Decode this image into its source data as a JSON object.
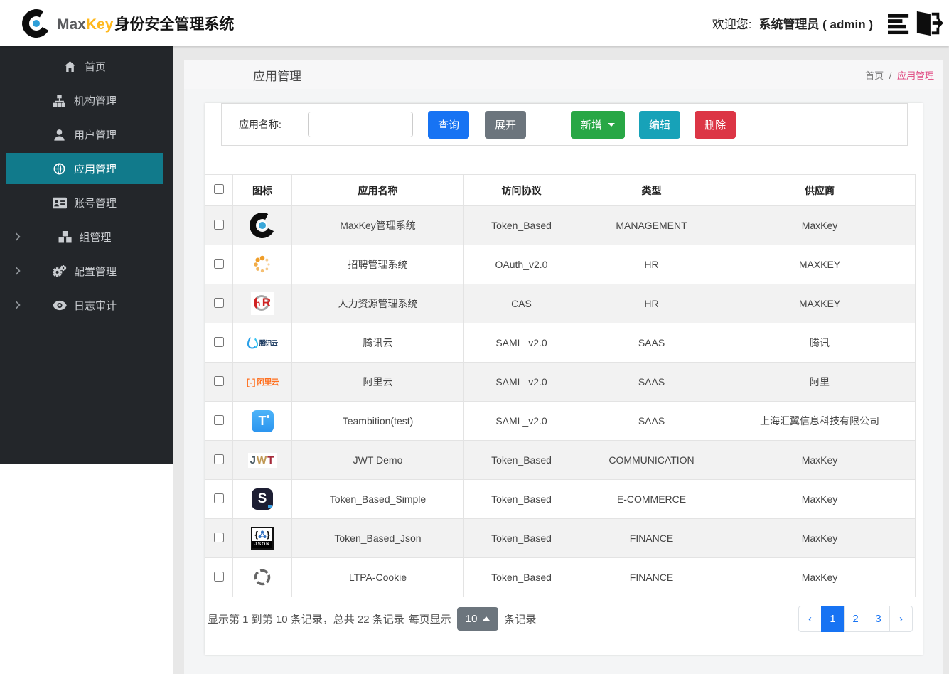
{
  "colors": {
    "primary_blue": "#1773f3",
    "green": "#28a745",
    "teal": "#17a2b8",
    "red": "#dc3545",
    "gray": "#6c757d",
    "sidebar_active": "#117a8b",
    "breadcrumb_pink": "#e0457f",
    "brand_yellow": "#ffb81c"
  },
  "header": {
    "logo": {
      "max": "Max",
      "key": "Key",
      "suffix": "身份安全管理系统"
    },
    "welcome_label": "欢迎您:",
    "user": "系统管理员 ( admin )",
    "icons": [
      "list-icon",
      "logout-icon"
    ]
  },
  "sidebar": {
    "items": [
      {
        "id": "home",
        "label": "首页",
        "icon": "home",
        "active": false,
        "expandable": false
      },
      {
        "id": "org",
        "label": "机构管理",
        "icon": "sitemap",
        "active": false,
        "expandable": false
      },
      {
        "id": "user",
        "label": "用户管理",
        "icon": "user",
        "active": false,
        "expandable": false
      },
      {
        "id": "app",
        "label": "应用管理",
        "icon": "globe",
        "active": true,
        "expandable": false
      },
      {
        "id": "account",
        "label": "账号管理",
        "icon": "idcard",
        "active": false,
        "expandable": false
      },
      {
        "id": "group",
        "label": "组管理",
        "icon": "cubes",
        "active": false,
        "expandable": true
      },
      {
        "id": "config",
        "label": "配置管理",
        "icon": "gears",
        "active": false,
        "expandable": true
      },
      {
        "id": "audit",
        "label": "日志审计",
        "icon": "eye",
        "active": false,
        "expandable": true
      }
    ]
  },
  "page": {
    "title": "应用管理",
    "breadcrumb": {
      "home": "首页",
      "separator": "/",
      "current": "应用管理"
    }
  },
  "toolbar": {
    "search_label": "应用名称:",
    "search_value": "",
    "query_label": "查询",
    "expand_label": "展开",
    "add_label": "新增",
    "edit_label": "编辑",
    "delete_label": "删除"
  },
  "table": {
    "columns": [
      "图标",
      "应用名称",
      "访问协议",
      "类型",
      "供应商"
    ],
    "rows": [
      {
        "icon": "maxkey",
        "name": "MaxKey管理系统",
        "protocol": "Token_Based",
        "type": "MANAGEMENT",
        "vendor": "MaxKey"
      },
      {
        "icon": "spinner",
        "name": "招聘管理系统",
        "protocol": "OAuth_v2.0",
        "type": "HR",
        "vendor": "MAXKEY"
      },
      {
        "icon": "hr",
        "name": "人力资源管理系统",
        "protocol": "CAS",
        "type": "HR",
        "vendor": "MAXKEY"
      },
      {
        "icon": "tencent",
        "name": "腾讯云",
        "protocol": "SAML_v2.0",
        "type": "SAAS",
        "vendor": "腾讯"
      },
      {
        "icon": "aliyun",
        "name": "阿里云",
        "protocol": "SAML_v2.0",
        "type": "SAAS",
        "vendor": "阿里"
      },
      {
        "icon": "teambition",
        "name": "Teambition(test)",
        "protocol": "SAML_v2.0",
        "type": "SAAS",
        "vendor": "上海汇翼信息科技有限公司"
      },
      {
        "icon": "jwt",
        "name": "JWT Demo",
        "protocol": "Token_Based",
        "type": "COMMUNICATION",
        "vendor": "MaxKey"
      },
      {
        "icon": "swagger",
        "name": "Token_Based_Simple",
        "protocol": "Token_Based",
        "type": "E-COMMERCE",
        "vendor": "MaxKey"
      },
      {
        "icon": "json",
        "name": "Token_Based_Json",
        "protocol": "Token_Based",
        "type": "FINANCE",
        "vendor": "MaxKey"
      },
      {
        "icon": "ltpa",
        "name": "LTPA-Cookie",
        "protocol": "Token_Based",
        "type": "FINANCE",
        "vendor": "MaxKey"
      }
    ]
  },
  "pagination": {
    "summary": "显示第 1 到第 10 条记录，总共 22 条记录",
    "page_size_label": "每页显示",
    "page_size": "10",
    "unit_label": "条记录",
    "prev": "‹",
    "next": "›",
    "pages": [
      "1",
      "2",
      "3"
    ],
    "active_page": "1"
  }
}
